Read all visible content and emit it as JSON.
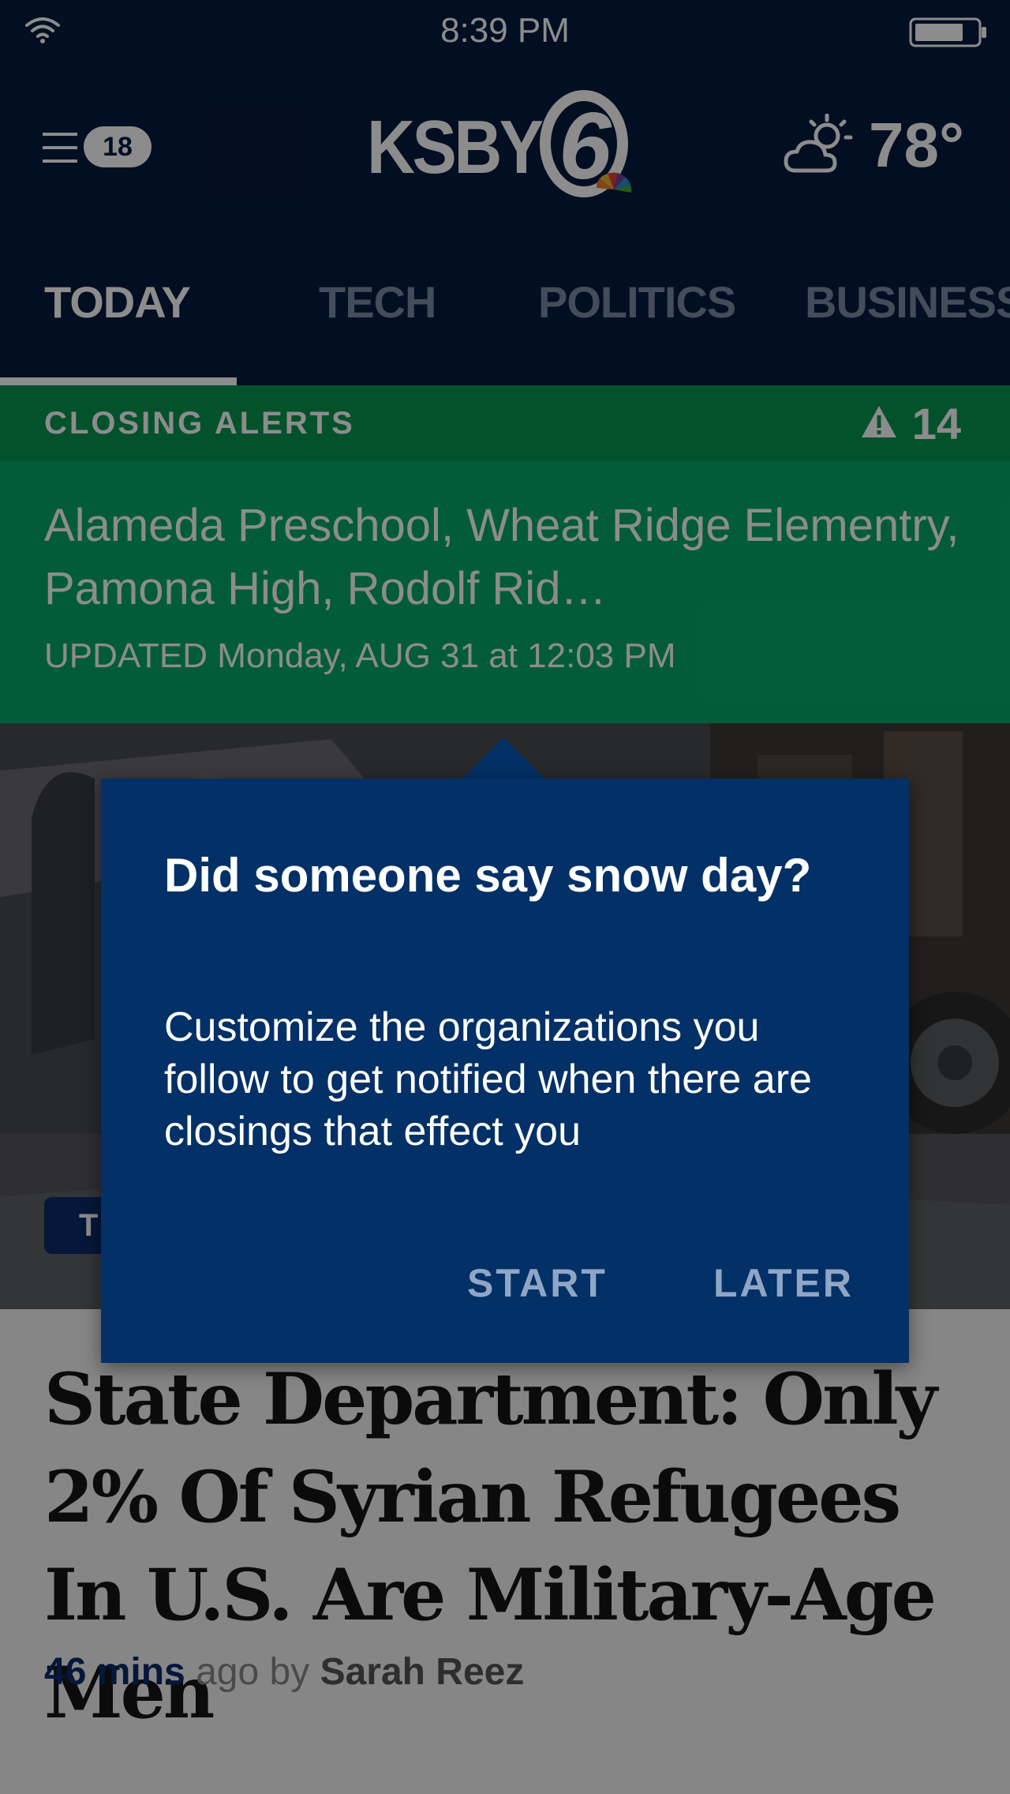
{
  "status_bar": {
    "time": "8:39 PM"
  },
  "header": {
    "menu_badge": "18",
    "logo_text": "KSBY",
    "logo_number": "6",
    "weather_temp": "78°"
  },
  "tabs": [
    {
      "label": "TODAY",
      "active": true
    },
    {
      "label": "TECH"
    },
    {
      "label": "POLITICS"
    },
    {
      "label": "BUSINESS"
    }
  ],
  "alerts": {
    "title": "CLOSING ALERTS",
    "count": "14",
    "text": "Alameda Preschool, Wheat Ridge Elementry, Pamona High, Rodolf Rid…",
    "updated": "UPDATED Monday, AUG 31 at 12:03 PM"
  },
  "hero": {
    "category_tag": "T"
  },
  "article": {
    "headline": "State Department: Only 2% Of Syrian Refugees In U.S. Are Military-Age Men",
    "time": "46 mins",
    "ago": " ago by ",
    "author": "Sarah Reez"
  },
  "popover": {
    "title": "Did someone say snow day?",
    "body": "Customize the organizations you follow to get notified when there are closings that effect you",
    "start_label": "START",
    "later_label": "LATER"
  },
  "colors": {
    "navy": "#051a3e",
    "alert_green_dark": "#079650",
    "alert_green": "#05a86b",
    "popover_bg": "#033066",
    "button_text": "#8fa6c6"
  }
}
